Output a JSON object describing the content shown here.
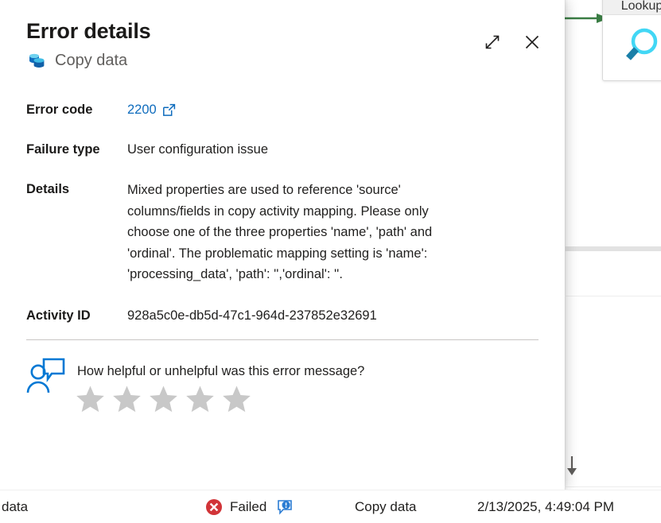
{
  "panel": {
    "title": "Error details",
    "subtitle": "Copy data",
    "subtitle_icon": "copy-data-icon",
    "expand_icon": "expand-diagonal-icon",
    "close_icon": "close-icon",
    "rows": [
      {
        "label": "Error code",
        "value": "2200",
        "is_link": true,
        "link_icon": "external-link-icon"
      },
      {
        "label": "Failure type",
        "value": "User configuration issue"
      },
      {
        "label": "Details",
        "value": "Mixed properties are used to reference 'source' columns/fields in copy activity mapping. Please only choose one of the three properties 'name', 'path' and 'ordinal'. The problematic mapping setting is 'name': 'processing_data', 'path': '','ordinal': ''."
      },
      {
        "label": "Activity ID",
        "value": "928a5c0e-db5d-47c1-964d-237852e32691"
      }
    ],
    "feedback": {
      "icon": "person-feedback-icon",
      "prompt": "How helpful or unhelpful was this error message?",
      "star_count": 5,
      "stars_filled": 0,
      "star_color": "#c8c8c8"
    }
  },
  "status_bar": {
    "activity_name": "data",
    "status_icon": "error-circle-x-icon",
    "status_text": "Failed",
    "comment_icon": "comment-alert-icon",
    "activity_type": "Copy data",
    "timestamp": "2/13/2025, 4:49:04 PM"
  },
  "background": {
    "lookup_card": {
      "title": "Lookup",
      "icon": "magnifier-icon"
    },
    "flow_arrow_icon": "green-arrow-right-icon",
    "sort_arrow_icon": "sort-descending-arrow-icon"
  },
  "colors": {
    "link": "#0f6cbd",
    "error": "#d13438",
    "accent_blue": "#0078d4",
    "arrow_green": "#3a7d44",
    "star_gray": "#c8c8c8"
  }
}
